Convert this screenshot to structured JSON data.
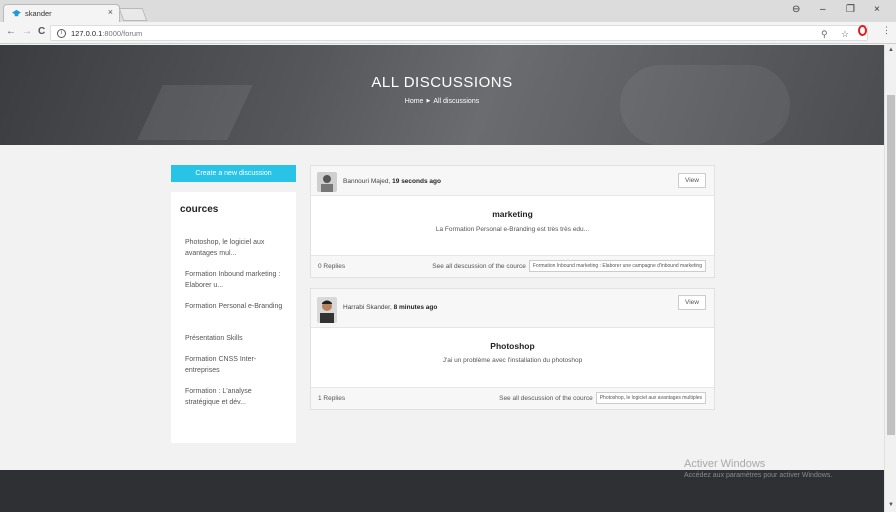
{
  "browser": {
    "tab_title": "skander",
    "tab_close": "×",
    "url_host": "127.0.0.1",
    "url_path": ":8000/forum",
    "info": "i",
    "back": "←",
    "forward": "→",
    "reload": "C",
    "account": "⊖",
    "minimize": "–",
    "restore": "❐",
    "close": "×",
    "search": "⚲",
    "star": "☆",
    "menu": "⋮"
  },
  "hero": {
    "title": "ALL DISCUSSIONS",
    "breadcrumb_home": "Home",
    "breadcrumb_sep": "▶",
    "breadcrumb_current": "All discussions"
  },
  "sidebar": {
    "create_button": "Create a new discussion",
    "title": "cources",
    "items": [
      "Photoshop, le logiciel aux avantages mul...",
      "Formation Inbound marketing : Elaborer u...",
      "Formation Personal e-Branding",
      "Présentation Skills",
      "Formation CNSS Inter-entreprises",
      "Formation : L'analyse stratégique et dév..."
    ]
  },
  "posts": [
    {
      "author": "Bannouri Majed,",
      "time": "19 seconds ago",
      "view": "View",
      "title": "marketing",
      "body": "La Formation Personal e-Branding est très très edu...",
      "replies": "0 Replies",
      "see_all": "See all descussion of the cource",
      "tags": [
        "Formation Inbound marketing : Elaborer une campagne d'inbound marketing"
      ]
    },
    {
      "author": "Harrabi Skander,",
      "time": "8 minutes ago",
      "view": "View",
      "title": "Photoshop",
      "body": "J'ai un problème avec l'installation du photoshop",
      "replies": "1 Replies",
      "see_all": "See all descussion of the cource",
      "tags": [
        "Photoshop, le logiciel aux avantages multiples"
      ]
    }
  ],
  "windows_watermark": {
    "title": "Activer Windows",
    "subtitle": "Accédez aux paramètres pour activer Windows."
  },
  "colors": {
    "accent": "#29c3e8",
    "footer": "#2f3033"
  }
}
